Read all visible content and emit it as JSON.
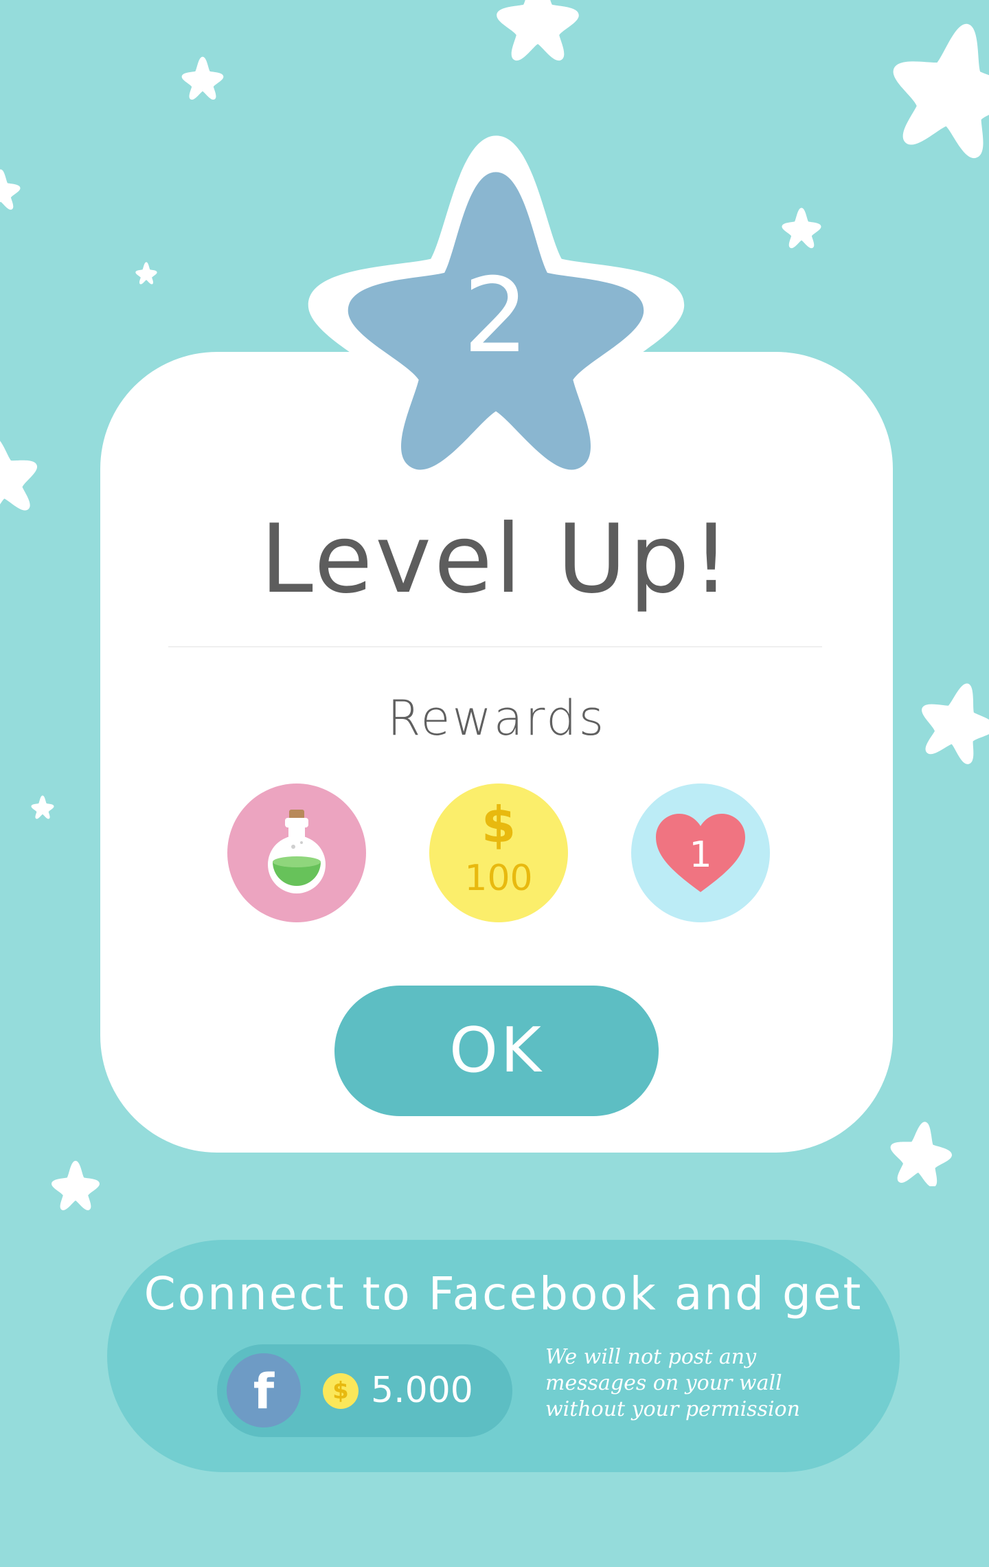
{
  "level_up": {
    "level_number": "2",
    "title": "Level Up!",
    "rewards_label": "Rewards",
    "rewards": [
      {
        "icon": "potion-icon"
      },
      {
        "icon": "dollar-icon",
        "symbol": "$",
        "amount": "100"
      },
      {
        "icon": "heart-icon",
        "count": "1"
      }
    ],
    "ok_label": "OK"
  },
  "facebook": {
    "heading": "Connect to Facebook and get",
    "logo_letter": "f",
    "coin_symbol": "$",
    "bonus_amount": "5.000",
    "note": "We will not post  any messages on your wall without your permission"
  },
  "colors": {
    "background": "#95dcdb",
    "card": "#ffffff",
    "level_star": "#8ab6d0",
    "button": "#5dbec3",
    "facebook_panel": "#73ced0",
    "facebook_blue": "#6e9bc5",
    "potion_bg": "#eca4c0",
    "coin_bg": "#fbee6b",
    "heart_bg": "#bcecf6",
    "heart": "#f07481"
  }
}
